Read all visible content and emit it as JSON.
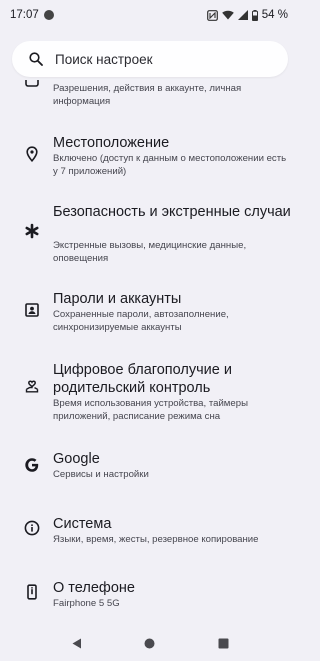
{
  "status_bar": {
    "time": "17:07",
    "battery": "54 %",
    "icons": [
      "notification-dot-icon",
      "nfc-icon",
      "wifi-icon",
      "signal-icon",
      "battery-icon"
    ]
  },
  "search": {
    "placeholder": "Поиск настроек"
  },
  "settings": {
    "items": [
      {
        "title": "",
        "subtitle": "Разрешения, действия в аккаунте, личная информация",
        "icon": "privacy-icon"
      },
      {
        "title": "Местоположение",
        "subtitle": "Включено (доступ к данным о местоположении есть у 7 приложений)",
        "icon": "location-icon"
      },
      {
        "title": "Безопасность и экстренные случаи",
        "subtitle": "Экстренные вызовы, медицинские данные, оповещения",
        "icon": "emergency-icon"
      },
      {
        "title": "Пароли и аккаунты",
        "subtitle": "Сохраненные пароли, автозаполнение, синхронизируемые аккаунты",
        "icon": "accounts-icon"
      },
      {
        "title": "Цифровое благополучие и родительский контроль",
        "subtitle": "Время использования устройства, таймеры приложений, расписание режима сна",
        "icon": "wellbeing-icon"
      },
      {
        "title": "Google",
        "subtitle": "Сервисы и настройки",
        "icon": "google-icon"
      },
      {
        "title": "Система",
        "subtitle": "Языки, время, жесты, резервное копирование",
        "icon": "system-info-icon"
      },
      {
        "title": "О телефоне",
        "subtitle": "Fairphone 5 5G",
        "icon": "phone-icon"
      }
    ]
  },
  "nav_bar": {
    "icons": [
      "back-icon",
      "home-icon",
      "recents-icon"
    ]
  }
}
